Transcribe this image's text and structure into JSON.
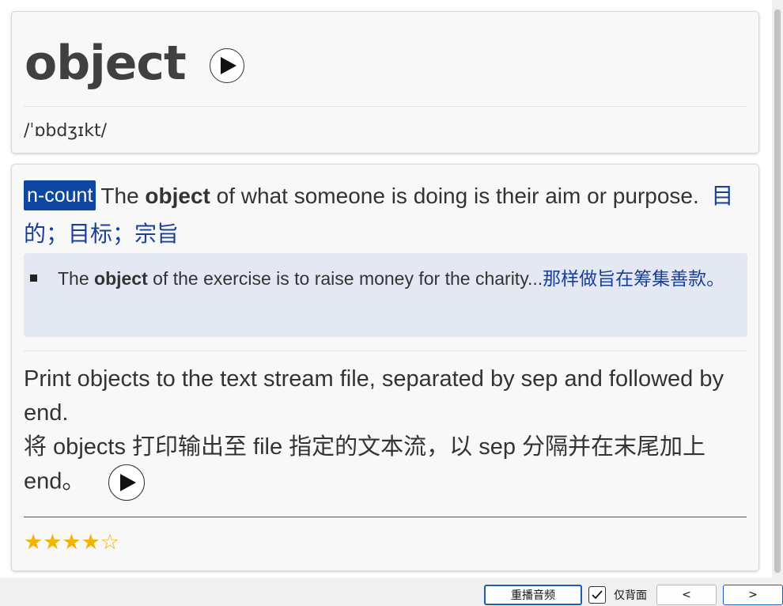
{
  "entry": {
    "headword": "object",
    "phonetic": "/ˈɒbdʒɪkt/"
  },
  "definition": {
    "pos": "n-count",
    "text_pre": "The ",
    "text_bold": "object",
    "text_post": " of what someone is doing is their aim or purpose.",
    "translation": "目的；目标；宗旨",
    "example": {
      "pre": "The ",
      "bold": "object",
      "post": " of the exercise is to raise money for the charity...",
      "translation": "那样做旨在筹集善款。"
    }
  },
  "sentence": {
    "english": "Print objects to the text stream file, separated by sep and followed by end.",
    "chinese": "将 objects 打印输出至 file 指定的文本流，以 sep 分隔并在末尾加上 end。"
  },
  "rating": {
    "filled": "★★★★",
    "empty": "☆",
    "value": 4,
    "max": 5
  },
  "toolbar": {
    "replay_label": "重播音频",
    "back_only_label": "仅背面",
    "back_only_checked": true,
    "prev_label": "<",
    "next_label": ">"
  },
  "colors": {
    "pos_badge": "#0d47a1",
    "translation": "#1a3f99",
    "example_bg": "#e3e8f2",
    "stars": "#f5b301"
  }
}
